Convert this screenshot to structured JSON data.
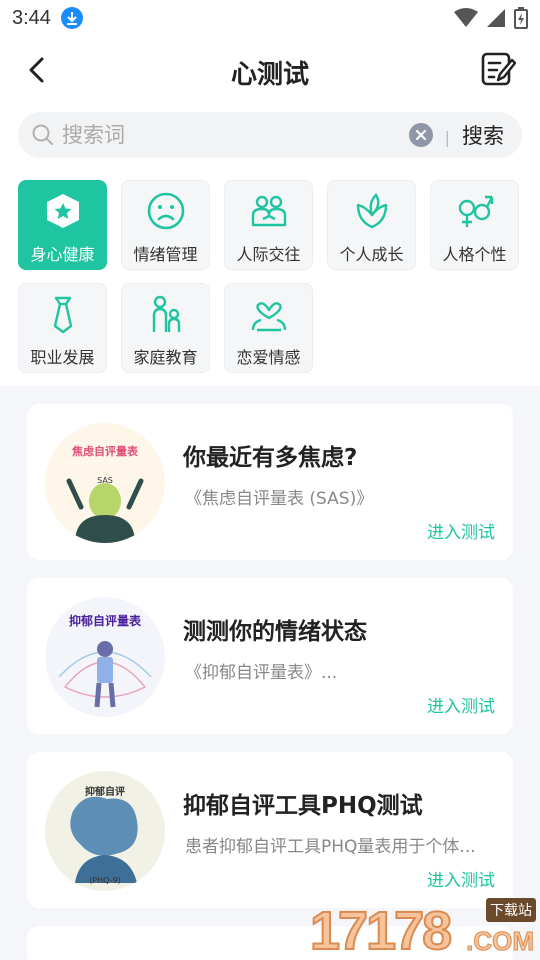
{
  "status_bar": {
    "time": "3:44"
  },
  "header": {
    "title": "心测试"
  },
  "search": {
    "placeholder": "搜索词",
    "submit_label": "搜索"
  },
  "categories": [
    {
      "label": "身心健康",
      "icon": "shield-star-icon",
      "active": true
    },
    {
      "label": "情绪管理",
      "icon": "sad-face-icon",
      "active": false
    },
    {
      "label": "人际交往",
      "icon": "people-icon",
      "active": false
    },
    {
      "label": "个人成长",
      "icon": "leaf-icon",
      "active": false
    },
    {
      "label": "人格个性",
      "icon": "gender-icon",
      "active": false
    },
    {
      "label": "职业发展",
      "icon": "tie-icon",
      "active": false
    },
    {
      "label": "家庭教育",
      "icon": "family-icon",
      "active": false
    },
    {
      "label": "恋爱情感",
      "icon": "heart-icon",
      "active": false
    }
  ],
  "tests": [
    {
      "title": "你最近有多焦虑?",
      "desc": "《焦虑自评量表 (SAS)》",
      "link": "进入测试",
      "thumb_title": "焦虑自评量表",
      "thumb_sub": "SAS",
      "thumb_bg": "#fdf6e9"
    },
    {
      "title": "测测你的情绪状态",
      "desc": "《抑郁自评量表》...",
      "link": "进入测试",
      "thumb_title": "抑郁自评量表",
      "thumb_sub": "",
      "thumb_bg": "#f3f5fa"
    },
    {
      "title": "抑郁自评工具PHQ测试",
      "desc": "患者抑郁自评工具PHQ量表用于个体...",
      "link": "进入测试",
      "thumb_title": "抑郁自评",
      "thumb_sub": "(PHQ-9)",
      "thumb_bg": "#f2f1e6"
    }
  ],
  "watermark": {
    "digits": "17178",
    "tag": "下载站",
    "com": ".COM"
  },
  "colors": {
    "accent": "#1fc4a1",
    "download_badge": "#1a8cff"
  }
}
